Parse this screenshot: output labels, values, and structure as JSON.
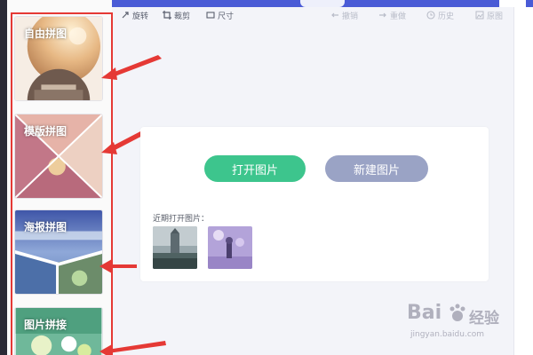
{
  "sidebar": {
    "cards": [
      {
        "label": "自由拼图"
      },
      {
        "label": "模版拼图"
      },
      {
        "label": "海报拼图"
      },
      {
        "label": "图片拼接"
      }
    ]
  },
  "toolbar": {
    "rotate": "旋转",
    "crop": "裁剪",
    "size": "尺寸",
    "undo": "撤销",
    "redo": "重做",
    "history": "历史",
    "original": "原图"
  },
  "main": {
    "open_button": "打开图片",
    "new_button": "新建图片",
    "recent_label": "近期打开图片："
  },
  "watermark": {
    "brand": "Bai",
    "brand2": "经验",
    "url": "jingyan.baidu.com"
  },
  "colors": {
    "accent_green": "#3dc58d",
    "accent_gray_blue": "#9aa3c5",
    "header_blue": "#4a5bd6",
    "annotation_red": "#e53935"
  },
  "icons": [
    "rotate-icon",
    "crop-icon",
    "size-icon",
    "undo-icon",
    "redo-icon",
    "history-icon",
    "image-icon"
  ]
}
